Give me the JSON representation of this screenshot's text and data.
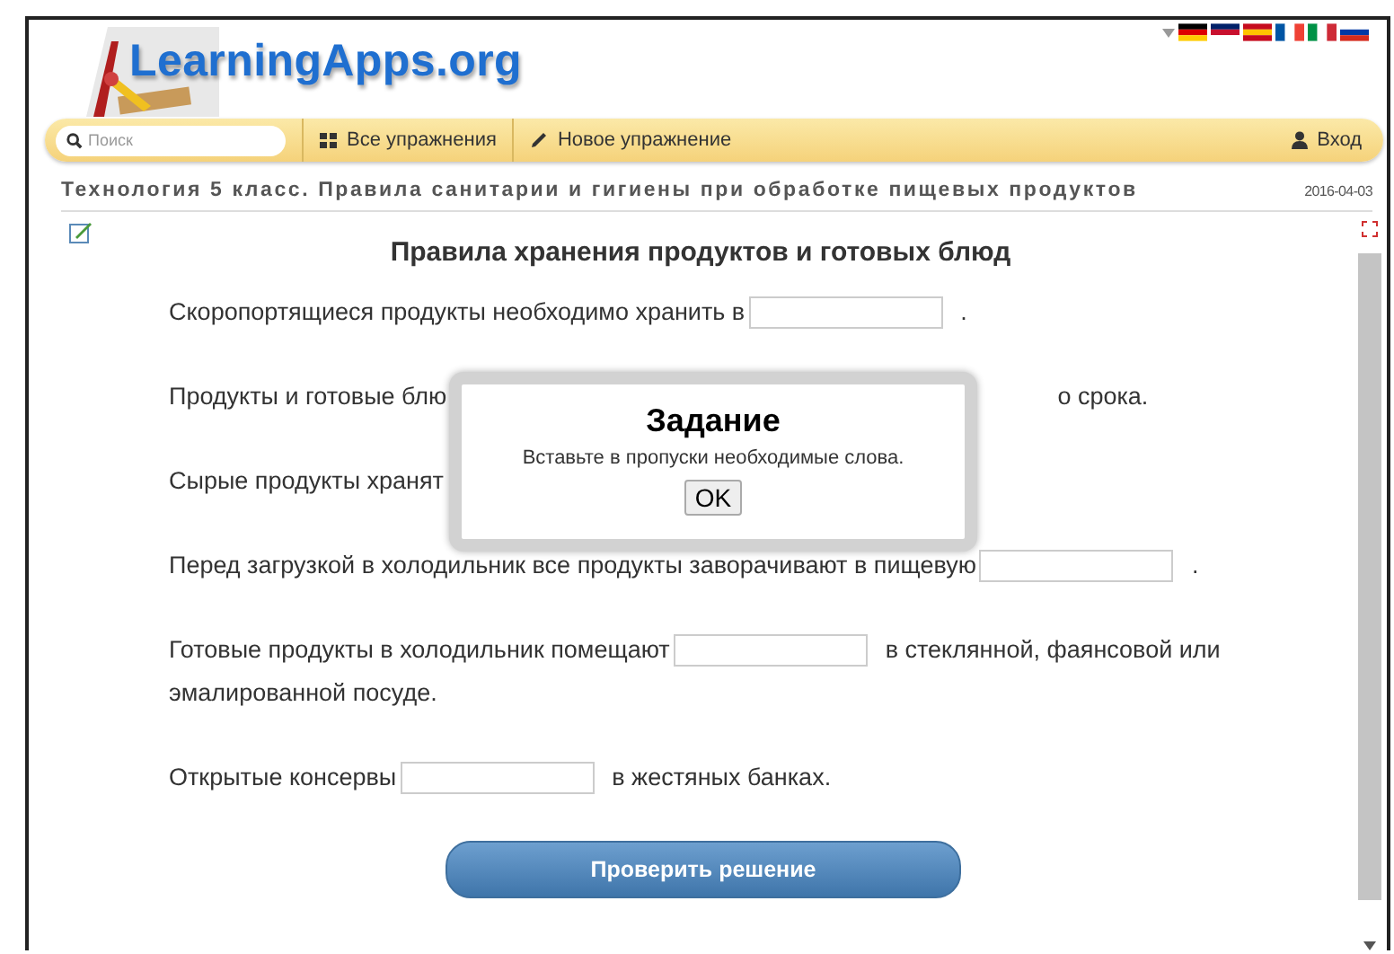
{
  "header": {
    "logo": "LearningApps.org"
  },
  "nav": {
    "search": {
      "placeholder": "Поиск"
    },
    "items": [
      {
        "label": "Все упражнения",
        "kind": "grid"
      },
      {
        "label": "Новое упражнение",
        "kind": "pencil"
      }
    ],
    "login": "Вход"
  },
  "page_title": "Технология 5 класс. Правила санитарии и гигиены при обработке пищевых продуктов",
  "date": "2016-04-03",
  "exercise": {
    "heading": "Правила хранения продуктов и готовых блюд",
    "sentences": [
      {
        "parts": [
          {
            "kind": "text",
            "text": "Скоропортящиеся продукты необходимо хранить в"
          },
          {
            "kind": "blank"
          },
          {
            "kind": "text",
            "text": "."
          }
        ]
      },
      {
        "parts": [
          {
            "kind": "text",
            "text": "Продукты и готовые блю"
          },
          {
            "kind": "covered"
          },
          {
            "kind": "text",
            "text": "о срока."
          }
        ]
      },
      {
        "parts": [
          {
            "kind": "text",
            "text": "Сырые продукты хранят"
          }
        ]
      },
      {
        "parts": [
          {
            "kind": "text",
            "text": "Перед загрузкой в холодильник все продукты заворачивают в пищевую"
          },
          {
            "kind": "blank"
          },
          {
            "kind": "text",
            "text": "."
          }
        ]
      },
      {
        "parts": [
          {
            "kind": "text",
            "text": "Готовые продукты в холодильник помещают"
          },
          {
            "kind": "blank"
          },
          {
            "kind": "text",
            "text": "в стеклянной, фаянсовой или"
          },
          {
            "kind": "text",
            "text": "эмалированной посуде."
          }
        ]
      },
      {
        "parts": [
          {
            "kind": "text",
            "text": "Открытые консервы"
          },
          {
            "kind": "blank"
          },
          {
            "kind": "text",
            "text": "в жестяных банках."
          }
        ]
      }
    ],
    "check_button": "Проверить решение"
  },
  "dialog": {
    "title": "Задание",
    "text": "Вставьте в пропуски необходимые слова.",
    "button": "OK"
  }
}
